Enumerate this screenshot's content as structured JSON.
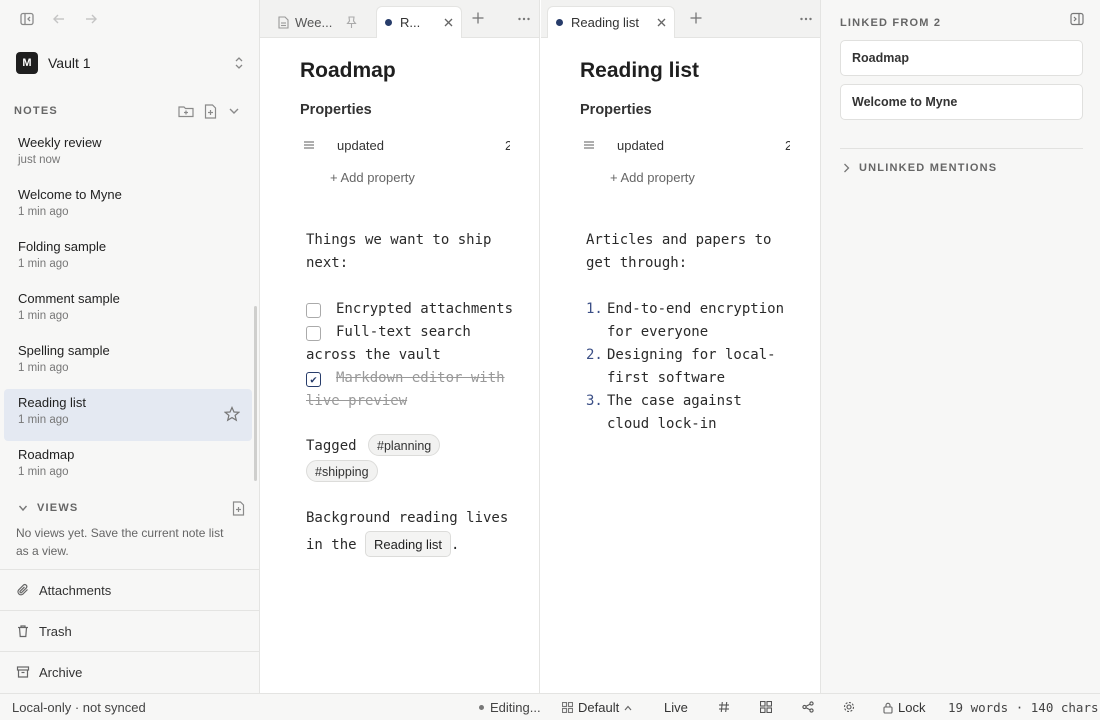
{
  "sidebar": {
    "vault": {
      "initial": "M",
      "name": "Vault 1"
    },
    "notes_header": "NOTES",
    "notes": [
      {
        "title": "Weekly review",
        "meta": "just now"
      },
      {
        "title": "Welcome to Myne",
        "meta": "1 min ago"
      },
      {
        "title": "Folding sample",
        "meta": "1 min ago"
      },
      {
        "title": "Comment sample",
        "meta": "1 min ago"
      },
      {
        "title": "Spelling sample",
        "meta": "1 min ago"
      },
      {
        "title": "Reading list",
        "meta": "1 min ago",
        "active": true
      },
      {
        "title": "Roadmap",
        "meta": "1 min ago"
      }
    ],
    "views_header": "VIEWS",
    "views_empty": "No views yet. Save the current note list as a view.",
    "bottom": {
      "attachments": "Attachments",
      "trash": "Trash",
      "archive": "Archive"
    }
  },
  "pane_left": {
    "tabs": [
      {
        "label": "Wee..."
      },
      {
        "label": "R..."
      }
    ],
    "title": "Roadmap",
    "properties_label": "Properties",
    "property": {
      "key": "updated",
      "value": "2"
    },
    "add_property": "+ Add property",
    "intro": "Things we want to ship next:",
    "tasks": [
      {
        "text": "Encrypted attachments",
        "checked": false
      },
      {
        "text": "Full-text search across the vault",
        "checked": false
      },
      {
        "text": "Markdown editor with live preview",
        "checked": true
      }
    ],
    "tagged_label": "Tagged",
    "tags": [
      "#planning",
      "#shipping"
    ],
    "outro_before": "Background reading lives in the",
    "outro_link": "Reading list",
    "outro_after": "."
  },
  "pane_right": {
    "tab": {
      "label": "Reading list"
    },
    "title": "Reading list",
    "properties_label": "Properties",
    "property": {
      "key": "updated",
      "value": "2"
    },
    "add_property": "+ Add property",
    "intro": "Articles and papers to get through:",
    "items": [
      {
        "num": "1.",
        "text": "End-to-end encryption for everyone"
      },
      {
        "num": "2.",
        "text": "Designing for local-first software"
      },
      {
        "num": "3.",
        "text": "The case against cloud lock-in"
      }
    ]
  },
  "linked_panel": {
    "header": "LINKED FROM 2",
    "links": [
      "Roadmap",
      "Welcome to Myne"
    ],
    "unlinked_header": "UNLINKED MENTIONS"
  },
  "statusbar": {
    "sync": "Local-only · not synced",
    "editing": "Editing...",
    "layout": "Default",
    "mode": "Live",
    "lock": "Lock",
    "counts": "19 words · 140 chars"
  },
  "colors": {
    "accent": "#273c6a",
    "active_row": "#e4e9f2",
    "sidebar_bg": "#f7f7f6"
  }
}
